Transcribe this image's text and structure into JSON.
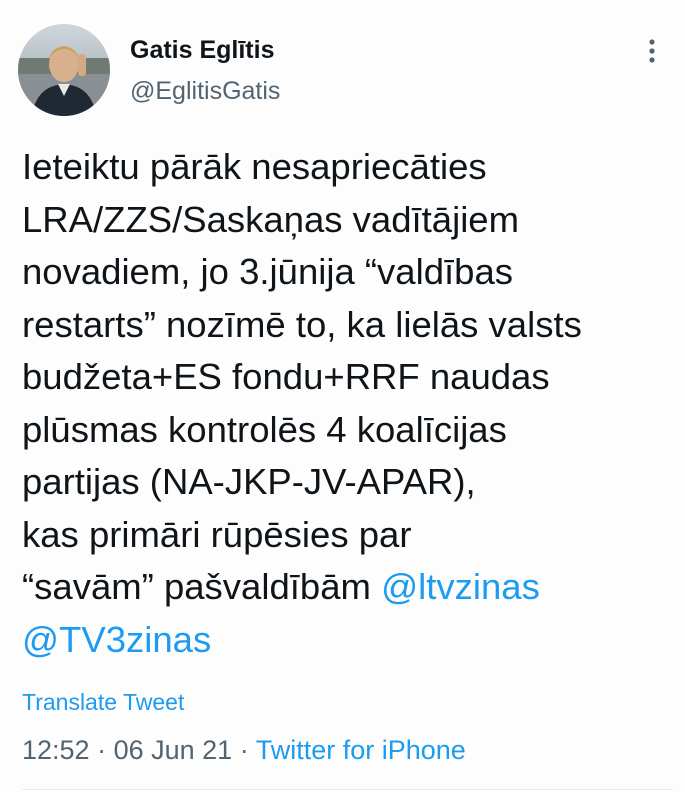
{
  "author": {
    "display_name": "Gatis Eglītis",
    "handle": "@EglitisGatis"
  },
  "tweet": {
    "lines": [
      "Ieteiktu pārāk nesapriecāties",
      "LRA/ZZS/Saskaņas vadītājiem",
      "novadiem, jo 3.jūnija “valdības",
      "restarts” nozīmē to, ka lielās valsts",
      "budžeta+ES fondu+RRF naudas",
      "plūsmas kontrolēs 4 koalīcijas",
      "partijas (NA-JKP-JV-APAR),",
      "kas primāri rūpēsies par"
    ],
    "last_line_text": "“savām” pašvaldībām ",
    "mention_1": "@ltvzinas",
    "mention_2": "@TV3zinas"
  },
  "translate_label": "Translate Tweet",
  "meta": {
    "time": "12:52",
    "separator": " · ",
    "date": "06 Jun 21",
    "source": "Twitter for iPhone"
  },
  "colors": {
    "link": "#1d9bf0",
    "text": "#0f1419",
    "secondary": "#536471"
  },
  "icons": {
    "more": "more-vertical-icon"
  }
}
